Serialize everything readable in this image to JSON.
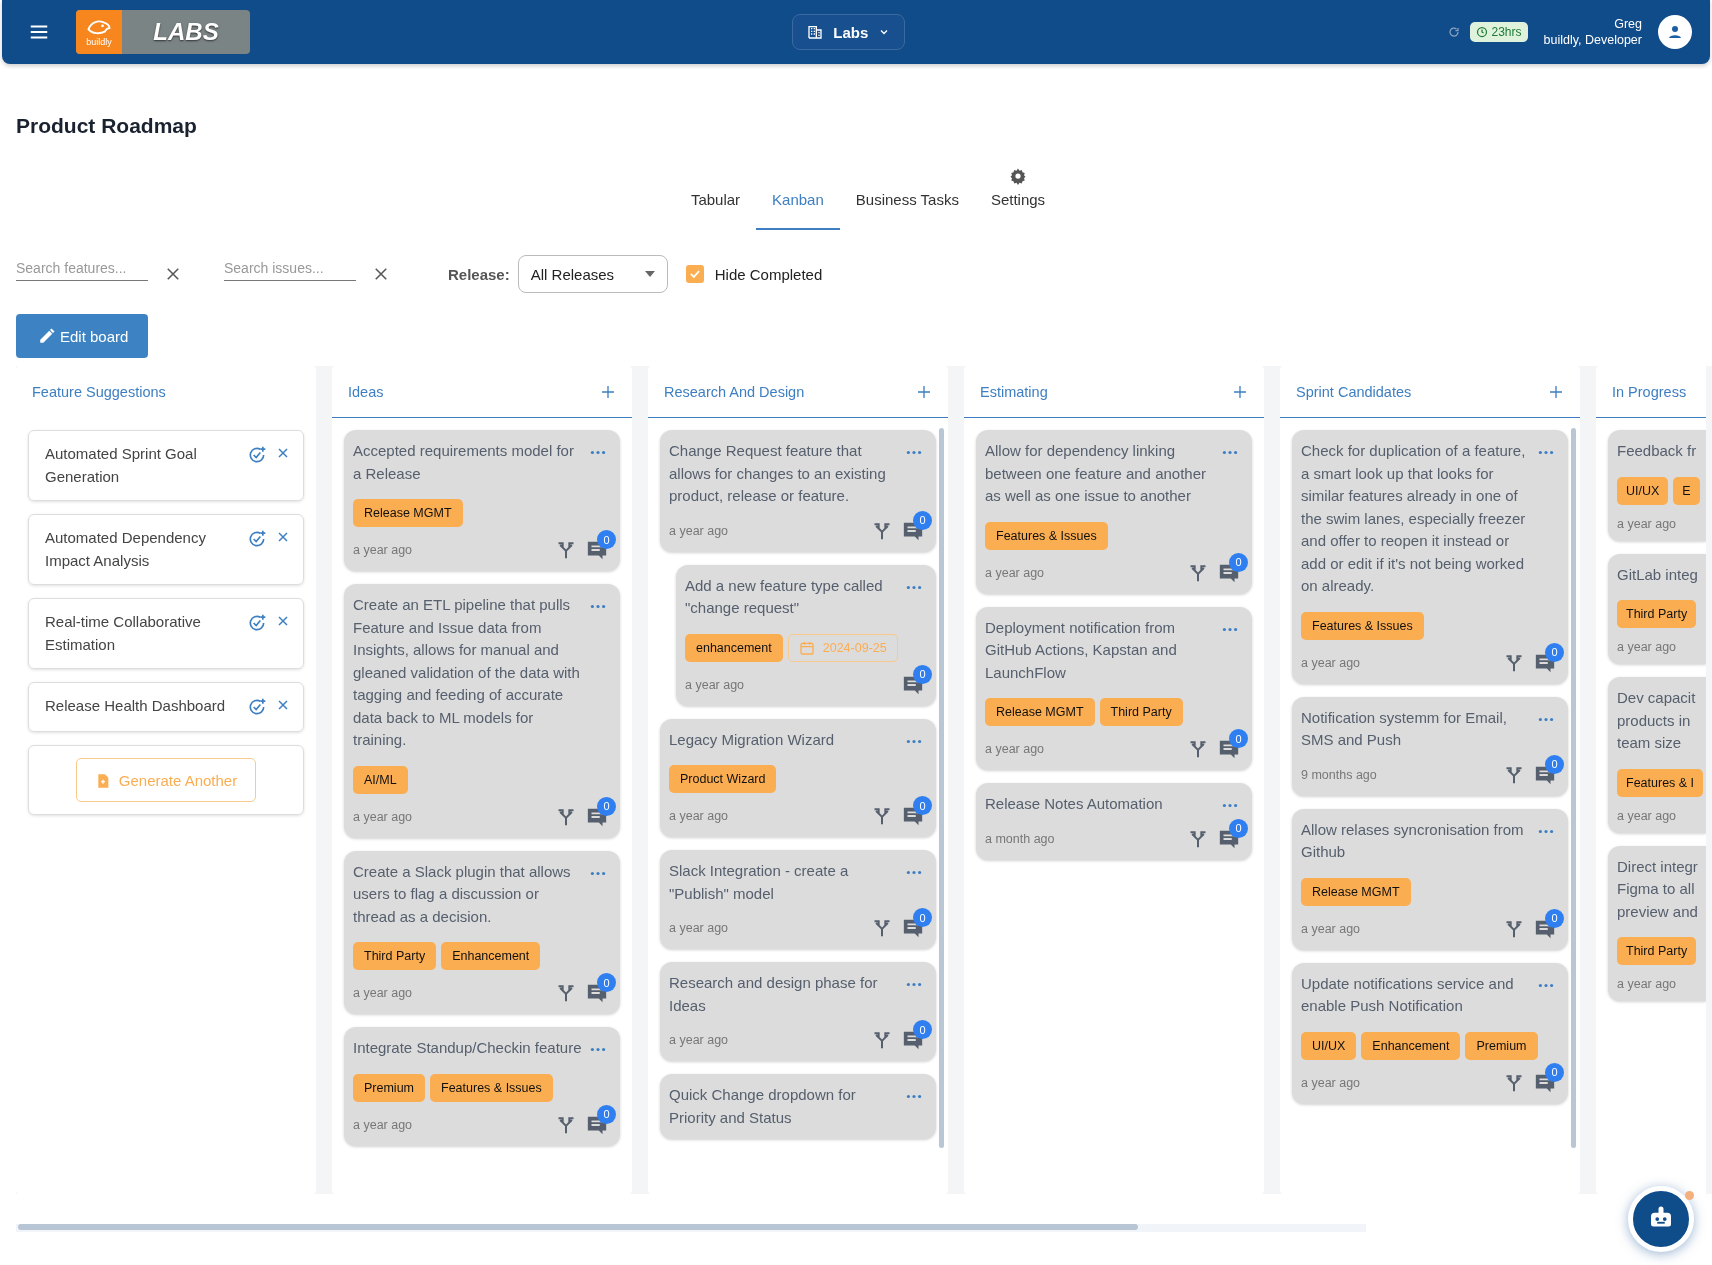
{
  "top_bar": {
    "logo": {
      "mark_text": "buildly",
      "title": "LABS"
    },
    "org_selector": {
      "label": "Labs"
    },
    "timer": "23hrs",
    "user": {
      "name": "Greg",
      "role": "buildly, Developer"
    }
  },
  "page_title": "Product Roadmap",
  "tabs": [
    {
      "label": "Tabular",
      "selected": false,
      "kind": "text"
    },
    {
      "label": "Kanban",
      "selected": true,
      "kind": "text"
    },
    {
      "label": "Business Tasks",
      "selected": false,
      "kind": "text"
    },
    {
      "label": "Settings",
      "selected": false,
      "kind": "gear"
    }
  ],
  "filters": {
    "feature_search": {
      "placeholder": "Search features..."
    },
    "issue_search": {
      "placeholder": "Search issues..."
    },
    "release_label": "Release:",
    "release_select": "All Releases",
    "hide_completed": {
      "label": "Hide Completed",
      "checked": true
    }
  },
  "edit_button": "Edit board",
  "columns": [
    {
      "kind": "suggestions",
      "title": "Feature Suggestions",
      "can_add": false,
      "scrollable": false,
      "items": [
        "Automated Sprint Goal Generation",
        "Automated Dependency Impact Analysis",
        "Real-time Collaborative Estimation",
        "Release Health Dashboard"
      ],
      "action": "Generate Another"
    },
    {
      "kind": "lane",
      "title": "Ideas",
      "can_add": true,
      "scrollable": false,
      "cards": [
        {
          "title": "Accepted requirements model for a Release",
          "tags": [
            "Release MGMT"
          ],
          "time": "a year ago",
          "fork": true,
          "comments": "0"
        },
        {
          "title": "Create an ETL pipeline that pulls Feature and Issue data from Insights, allows for manual and gleaned validation of the data with tagging and feeding of accurate data back to ML models for training.",
          "tags": [
            "AI/ML"
          ],
          "time": "a year ago",
          "fork": true,
          "comments": "0"
        },
        {
          "title": "Create a Slack plugin that allows users to flag a discussion or thread as a decision.",
          "tags": [
            "Third Party",
            "Enhancement"
          ],
          "time": "a year ago",
          "fork": true,
          "comments": "0"
        },
        {
          "title": "Integrate Standup/Checkin feature",
          "tags": [
            "Premium",
            "Features & Issues"
          ],
          "time": "a year ago",
          "fork": true,
          "comments": "0"
        }
      ]
    },
    {
      "kind": "lane",
      "title": "Research And Design",
      "can_add": true,
      "scrollable": true,
      "cards": [
        {
          "title": "Change Request feature that allows for changes to an existing product, release or feature.",
          "time": "a year ago",
          "fork": true,
          "comments": "0",
          "children": [
            {
              "title": "Add a new feature type called \"change request\"",
              "tags": [
                "enhancement"
              ],
              "date": "2024-09-25",
              "time": "a year ago",
              "fork": false,
              "comments": "0"
            }
          ]
        },
        {
          "title": "Legacy Migration Wizard",
          "tags": [
            "Product Wizard"
          ],
          "time": "a year ago",
          "fork": true,
          "comments": "0"
        },
        {
          "title": "Slack Integration - create a \"Publish\" model",
          "time": "a year ago",
          "fork": true,
          "comments": "0"
        },
        {
          "title": "Research and design phase for Ideas",
          "time": "a year ago",
          "fork": true,
          "comments": "0"
        },
        {
          "title": "Quick Change dropdown for Priority and Status"
        }
      ]
    },
    {
      "kind": "lane",
      "title": "Estimating",
      "can_add": true,
      "scrollable": false,
      "cards": [
        {
          "title": "Allow for dependency linking between one feature and another as well as one issue to another",
          "tags": [
            "Features & Issues"
          ],
          "time": "a year ago",
          "fork": true,
          "comments": "0"
        },
        {
          "title": "Deployment notification from GitHub Actions, Kapstan and LaunchFlow",
          "tags": [
            "Release MGMT",
            "Third Party"
          ],
          "time": "a year ago",
          "fork": true,
          "comments": "0"
        },
        {
          "title": "Release Notes Automation",
          "time": "a month ago",
          "fork": true,
          "comments": "0"
        }
      ]
    },
    {
      "kind": "lane",
      "title": "Sprint Candidates",
      "can_add": true,
      "scrollable": true,
      "cards": [
        {
          "title": "Check for duplication of a feature, a smart look up that looks for similar features already in one of the swim lanes, especially freezer and offer to reopen it instead or add or edit if it's not being worked on already.",
          "tags": [
            "Features & Issues"
          ],
          "time": "a year ago",
          "fork": true,
          "comments": "0"
        },
        {
          "title": "Notification systemm for Email, SMS and Push",
          "time": "9 months ago",
          "fork": true,
          "comments": "0"
        },
        {
          "title": "Allow relases syncronisation from Github",
          "tags": [
            "Release MGMT"
          ],
          "time": "a year ago",
          "fork": true,
          "comments": "0"
        },
        {
          "title": "Update notifications service and enable Push Notification",
          "tags": [
            "UI/UX",
            "Enhancement",
            "Premium"
          ],
          "time": "a year ago",
          "fork": true,
          "comments": "0"
        }
      ]
    },
    {
      "kind": "cut",
      "title": "In Progress",
      "can_add": false,
      "scrollable": false,
      "cards": [
        {
          "title": "Feedback fr",
          "tags": [
            "UI/UX",
            "E"
          ],
          "time": "a year ago",
          "fork": false
        },
        {
          "title": "GitLab integ",
          "tags": [
            "Third Party"
          ],
          "time": "a year ago",
          "fork": false
        },
        {
          "title": "Dev capacit\nproducts in\nteam size",
          "tags": [
            "Features & I"
          ],
          "time": "a year ago",
          "fork": false
        },
        {
          "title": "Direct integr\nFigma to all\npreview and",
          "tags": [
            "Third Party"
          ],
          "time": "a year ago",
          "fork": false
        }
      ]
    }
  ]
}
